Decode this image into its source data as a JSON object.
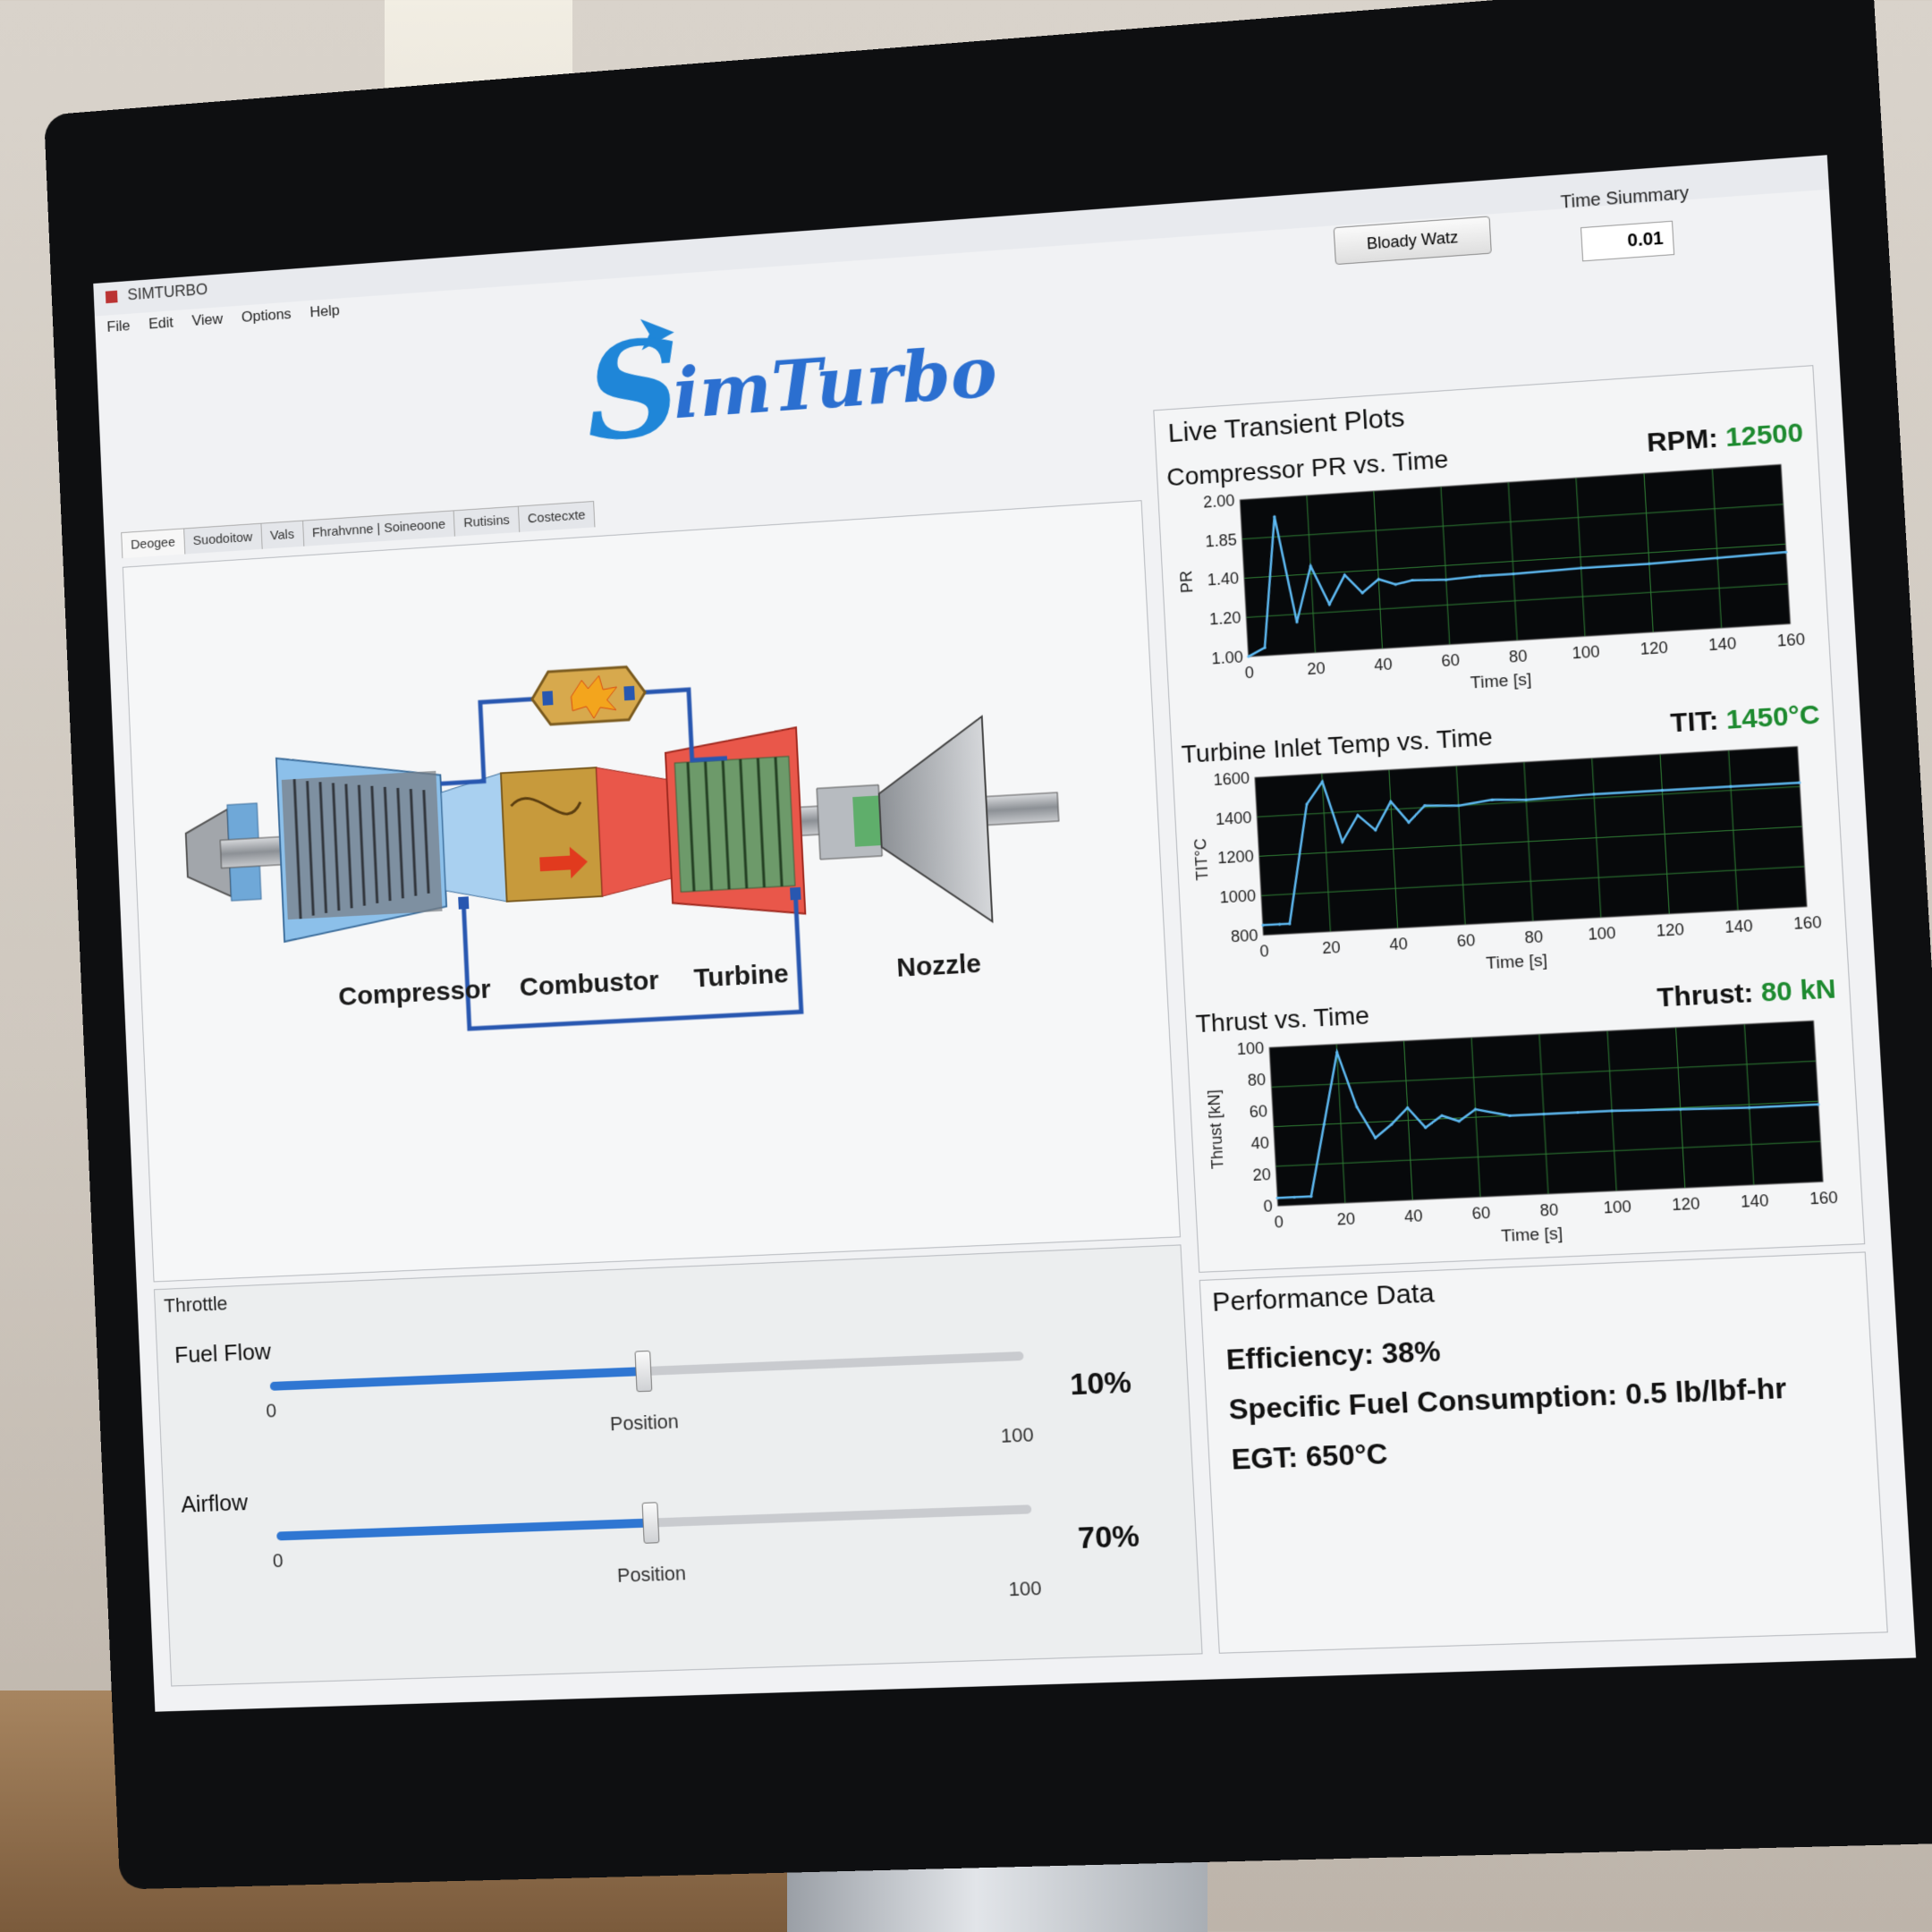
{
  "window": {
    "title": "SIMTURBO",
    "menu": [
      "File",
      "Edit",
      "View",
      "Options",
      "Help"
    ],
    "controls": {
      "minimize": "▁",
      "restore": "❐",
      "close": "✕"
    }
  },
  "logo": {
    "text": "imTurbo",
    "initial": "S"
  },
  "toolbar": {
    "button_label": "Bloady Watz"
  },
  "time_summary": {
    "label": "Time Siummary",
    "value": "0.01"
  },
  "tabs": [
    "Deogee",
    "Suodoitow",
    "Vals",
    "Fhrahvnne | Soineoone",
    "Rutisins",
    "Costecxte"
  ],
  "diagram": {
    "labels": {
      "compressor": "Compressor",
      "combustor": "Combustor",
      "turbine": "Turbine",
      "nozzle": "Nozzle"
    }
  },
  "plots": {
    "title": "Live Transient Plots",
    "pr": {
      "title": "Compressor PR vs. Time",
      "readout_label": "RPM:",
      "readout_value": "12500"
    },
    "tit": {
      "title": "Turbine Inlet Temp vs. Time",
      "readout_label": "TIT:",
      "readout_value": "1450°C"
    },
    "thrust": {
      "title": "Thrust vs. Time",
      "readout_label": "Thrust:",
      "readout_value": "80 kN"
    }
  },
  "chart_data": [
    {
      "type": "line",
      "title": "Compressor PR vs. Time",
      "xlabel": "Time [s]",
      "ylabel": "PR",
      "xlim": [
        0,
        160
      ],
      "ylim": [
        1.0,
        2.0
      ],
      "xticks": [
        "0",
        "20",
        "40",
        "60",
        "80",
        "100",
        "120",
        "140",
        "160"
      ],
      "yticks": [
        "2.00",
        "1.85",
        "1.40",
        "1.20",
        "1.00"
      ],
      "x": [
        0,
        5,
        10,
        15,
        20,
        25,
        30,
        35,
        40,
        45,
        50,
        60,
        70,
        80,
        100,
        120,
        140,
        160
      ],
      "y": [
        1.0,
        1.05,
        1.88,
        1.2,
        1.55,
        1.3,
        1.48,
        1.36,
        1.44,
        1.4,
        1.42,
        1.41,
        1.42,
        1.42,
        1.43,
        1.43,
        1.44,
        1.45
      ]
    },
    {
      "type": "line",
      "title": "Turbine Inlet Temp vs. Time",
      "xlabel": "Time [s]",
      "ylabel": "TIT°C",
      "xlim": [
        0,
        160
      ],
      "ylim": [
        800,
        1600
      ],
      "xticks": [
        "0",
        "20",
        "40",
        "60",
        "80",
        "100",
        "120",
        "140",
        "160"
      ],
      "yticks": [
        "1600",
        "1400",
        "1200",
        "1000",
        "800"
      ],
      "x": [
        0,
        5,
        8,
        15,
        20,
        25,
        30,
        35,
        40,
        45,
        50,
        60,
        70,
        80,
        100,
        120,
        140,
        160
      ],
      "y": [
        850,
        850,
        850,
        1450,
        1560,
        1250,
        1380,
        1300,
        1440,
        1330,
        1410,
        1400,
        1420,
        1410,
        1420,
        1420,
        1420,
        1420
      ]
    },
    {
      "type": "line",
      "title": "Thrust vs. Time",
      "xlabel": "Time [s]",
      "ylabel": "Thrust [kN]",
      "xlim": [
        0,
        160
      ],
      "ylim": [
        0,
        100
      ],
      "xticks": [
        "0",
        "20",
        "40",
        "60",
        "80",
        "100",
        "120",
        "140",
        "160"
      ],
      "yticks": [
        "100",
        "80",
        "60",
        "40",
        "20",
        "0"
      ],
      "x": [
        0,
        5,
        10,
        15,
        20,
        25,
        30,
        35,
        40,
        45,
        50,
        55,
        60,
        70,
        80,
        90,
        100,
        120,
        140,
        160
      ],
      "y": [
        5,
        5,
        5,
        50,
        95,
        60,
        40,
        48,
        58,
        45,
        52,
        48,
        55,
        50,
        50,
        50,
        50,
        49,
        48,
        48
      ]
    }
  ],
  "controls": {
    "title": "Throttle",
    "fuel": {
      "label": "Fuel Flow",
      "min": "0",
      "max": "100",
      "position_label": "Position",
      "value_text": "10%",
      "position": 0.5
    },
    "air": {
      "label": "Airflow",
      "min": "0",
      "max": "100",
      "position_label": "Position",
      "value_text": "70%",
      "position": 0.5
    }
  },
  "performance": {
    "title": "Performance Data",
    "efficiency": "Efficiency: 38%",
    "sfc": "Specific Fuel Consumption: 0.5 lb/lbf-hr",
    "egt": "EGT: 650°C"
  },
  "colors": {
    "accent": "#2f76d2",
    "readout_green": "#1d8a2f",
    "trace": "#5db8f0",
    "plot_bg": "#07090b",
    "grid": "#2f7d34"
  }
}
